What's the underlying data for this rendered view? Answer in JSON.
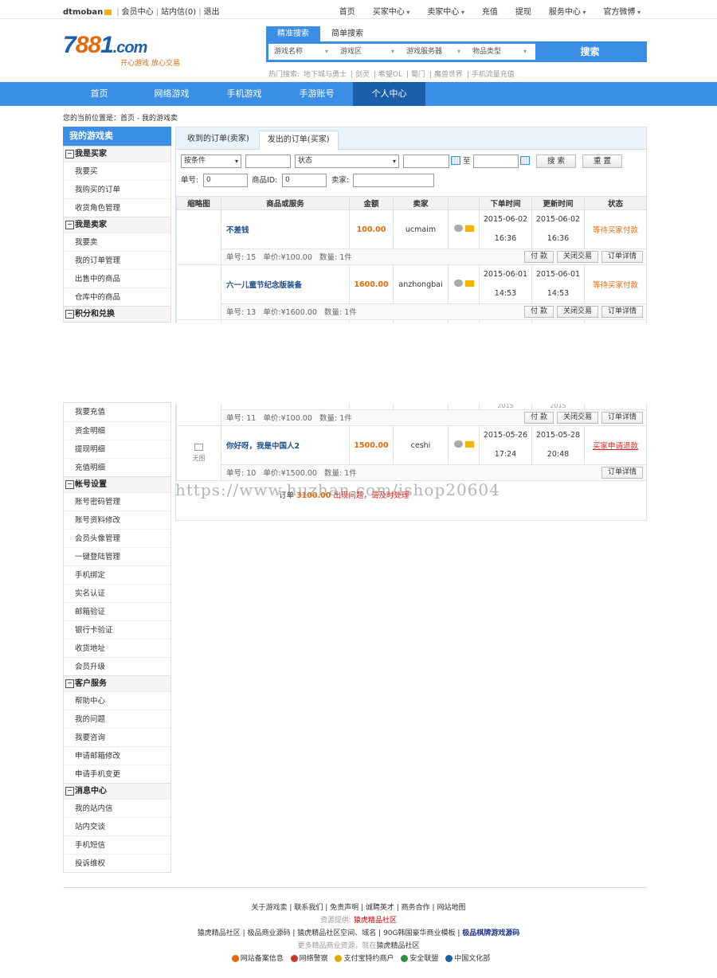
{
  "topbar": {
    "username": "dtmoban",
    "links": [
      "会员中心",
      "站内信(0)",
      "退出"
    ],
    "nav": [
      {
        "label": "首页",
        "dropdown": false
      },
      {
        "label": "买家中心",
        "dropdown": true
      },
      {
        "label": "卖家中心",
        "dropdown": true
      },
      {
        "label": "充值",
        "dropdown": false
      },
      {
        "label": "提现",
        "dropdown": false
      },
      {
        "label": "服务中心",
        "dropdown": true
      },
      {
        "label": "官方微博",
        "dropdown": true
      }
    ]
  },
  "logo": {
    "text_a": "7",
    "text_b": "88",
    "text_c": "1",
    "text_d": ".com",
    "slogan": "开心游戏 放心交易"
  },
  "search": {
    "tabs": [
      "精准搜索",
      "简单搜索"
    ],
    "fields": [
      "游戏名称",
      "游戏区",
      "游戏服务器",
      "物品类型"
    ],
    "button": "搜索",
    "hot_label": "热门搜索:",
    "hot": [
      "地下城与勇士",
      "剑灵",
      "希望OL",
      "蜀门",
      "魔兽世界",
      "手机流量充值"
    ]
  },
  "mainnav": [
    "首页",
    "网络游戏",
    "手机游戏",
    "手游账号",
    "个人中心"
  ],
  "breadcrumb": "您的当前位置是：首页 - 我的游戏卖",
  "sidebar": {
    "title": "我的游戏卖",
    "groups_top": [
      {
        "head": "我是买家",
        "items": [
          "我要买",
          "我购买的订单",
          "收货角色管理"
        ]
      },
      {
        "head": "我是卖家",
        "items": [
          "我要卖",
          "我的订单管理",
          "出售中的商品",
          "仓库中的商品"
        ]
      },
      {
        "head": "积分和兑换",
        "items": []
      }
    ],
    "mid_items": [
      "我要充值",
      "资金明细",
      "提现明细",
      "充值明细"
    ],
    "groups_bottom": [
      {
        "head": "帐号设置",
        "items": [
          "账号密码管理",
          "账号资料修改",
          "会员头像管理",
          "一键登陆管理",
          "手机绑定",
          "实名认证",
          "邮箱验证",
          "银行卡验证",
          "收货地址",
          "会员升级"
        ]
      },
      {
        "head": "客户服务",
        "items": [
          "帮助中心",
          "我的问题",
          "我要咨询",
          "申请邮箱修改",
          "申请手机变更"
        ]
      },
      {
        "head": "消息中心",
        "items": [
          "我的站内信",
          "站内交谈",
          "手机短信",
          "投诉维权"
        ]
      }
    ]
  },
  "content": {
    "tabs": [
      "收到的订单(卖家)",
      "发出的订单(买家)"
    ],
    "filters": {
      "condition": "按条件",
      "status": "状态",
      "to": "至",
      "search": "搜 索",
      "reset": "重 置",
      "order_no_label": "单号:",
      "order_no": "0",
      "goods_id_label": "商品ID:",
      "goods_id": "0",
      "seller_label": "卖家:"
    },
    "columns": [
      "缩略图",
      "商品或服务",
      "金额",
      "卖家",
      "",
      "下单时间",
      "更新时间",
      "状态"
    ],
    "labels": {
      "order_no": "单号:",
      "price": "单价:",
      "qty": "数量:",
      "pay": "付 款",
      "close": "关闭交易",
      "detail": "订单详情",
      "noimg": "无图"
    },
    "orders": [
      {
        "name": "不差钱",
        "amount": "100.00",
        "seller": "ucmaim",
        "created_date": "2015-06-02",
        "created_time": "16:36",
        "updated_date": "2015-06-02",
        "updated_time": "16:36",
        "status": "等待买家付款",
        "no": "15",
        "price": "¥100.00",
        "qty": "1件"
      },
      {
        "name": "六一儿童节纪念版装备",
        "amount": "1600.00",
        "seller": "anzhongbai",
        "created_date": "2015-06-01",
        "created_time": "14:53",
        "updated_date": "2015-06-01",
        "updated_time": "14:53",
        "status": "等待买家付款",
        "no": "13",
        "price": "¥1600.00",
        "qty": "1件"
      }
    ],
    "partial_row": {
      "no": "11",
      "price": "¥100.00",
      "qty": "1件",
      "created_partial": "2015",
      "updated_partial": "2015"
    },
    "last_order": {
      "name": "你好呀，我是中国人2",
      "amount": "1500.00",
      "seller": "ceshi",
      "created_date": "2015-05-26",
      "created_time": "17:24",
      "updated_date": "2015-05-28",
      "updated_time": "20:48",
      "status": "买家申请退款",
      "no": "10",
      "price": "¥1500.00",
      "qty": "1件"
    },
    "overlay": {
      "prefix": "订单",
      "amount": "3100.00",
      "text": "出现问题，请及时处理"
    }
  },
  "watermark": "https://www.huzhan.com/ishop20604",
  "footer": {
    "links": [
      "关于游戏卖",
      "联系我们",
      "免责声明",
      "诚聘英才",
      "商务合作",
      "网站地图"
    ],
    "provider_label": "资源提供:",
    "provider": "猿虎精品社区",
    "links2": [
      "猿虎精品社区",
      "极品商业源码",
      "猿虎精品社区空间、域名",
      "90G韩国豪华商业模板"
    ],
    "links2_bold": "极品棋牌游戏源码",
    "more_label": "更多精品商业资源，就在",
    "more_site": "猿虎精品社区",
    "badges": [
      {
        "label": "网站备案信息",
        "color": "#e46a0b"
      },
      {
        "label": "网络警察",
        "color": "#c0392b"
      },
      {
        "label": "支付宝特约商户",
        "color": "#e6a700"
      },
      {
        "label": "安全联盟",
        "color": "#2f8d3c"
      },
      {
        "label": "中国文化部",
        "color": "#1c5fa8"
      }
    ]
  }
}
